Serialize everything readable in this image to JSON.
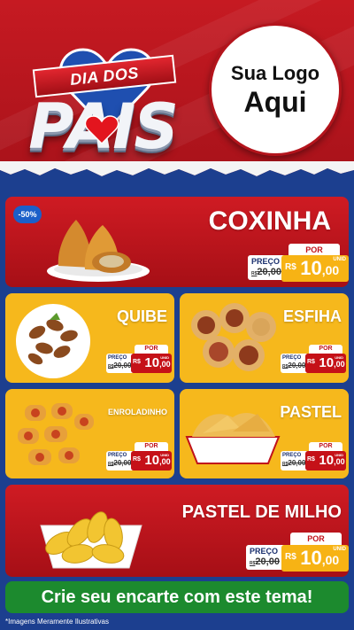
{
  "header": {
    "ribbon_text": "DIA DOS",
    "big_text": "PAIS",
    "logo_line1": "Sua Logo",
    "logo_line2": "Aqui"
  },
  "featured": {
    "badge": "-50%",
    "name": "COXINHA",
    "por": "POR",
    "preco_label": "PREÇO",
    "currency_small": "R$",
    "old_price": "20,00",
    "currency": "R$",
    "new_int": "10",
    "new_dec": ",00",
    "unid": "UNID"
  },
  "items": [
    {
      "name": "QUIBE",
      "por": "POR",
      "preco_label": "PREÇO",
      "currency_small": "R$",
      "old_price": "20,00",
      "currency": "R$",
      "new_int": "10",
      "new_dec": ",00",
      "unid": "UNID"
    },
    {
      "name": "ESFIHA",
      "por": "POR",
      "preco_label": "PREÇO",
      "currency_small": "R$",
      "old_price": "20,00",
      "currency": "R$",
      "new_int": "10",
      "new_dec": ",00",
      "unid": "UNID"
    },
    {
      "name": "ENROLADINHO",
      "por": "POR",
      "preco_label": "PREÇO",
      "currency_small": "R$",
      "old_price": "20,00",
      "currency": "R$",
      "new_int": "10",
      "new_dec": ",00",
      "unid": "UNID"
    },
    {
      "name": "PASTEL",
      "por": "POR",
      "preco_label": "PREÇO",
      "currency_small": "R$",
      "old_price": "20,00",
      "currency": "R$",
      "new_int": "10",
      "new_dec": ",00",
      "unid": "UNID"
    }
  ],
  "bottom": {
    "name": "PASTEL DE MILHO",
    "por": "POR",
    "preco_label": "PREÇO",
    "currency_small": "R$",
    "old_price": "20,00",
    "currency": "R$",
    "new_int": "10",
    "new_dec": ",00",
    "unid": "UNID"
  },
  "cta": "Crie seu encarte com este tema!",
  "disclaimer": "*Imagens Meramente Ilustrativas",
  "colors": {
    "red": "#c61a22",
    "yellow": "#f6b81c",
    "blue": "#1c3f8f",
    "green": "#1c8a2e"
  }
}
